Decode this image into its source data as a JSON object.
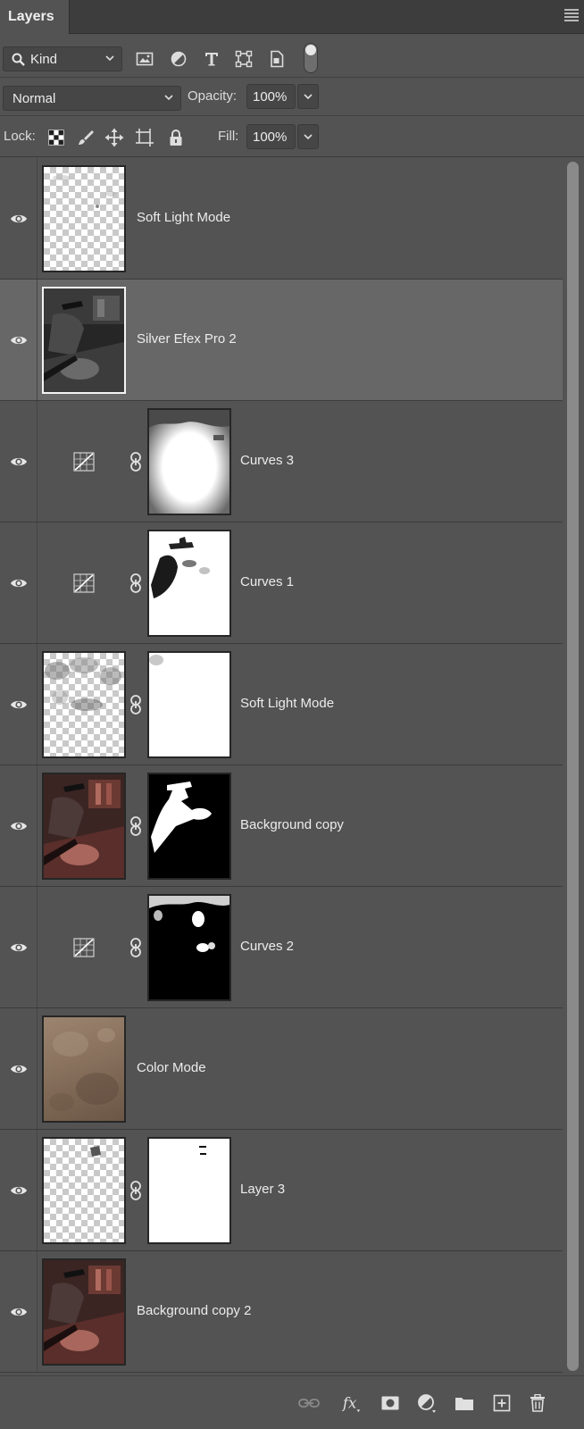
{
  "panel": {
    "tab_title": "Layers"
  },
  "filter": {
    "kind_label": "Kind"
  },
  "blend": {
    "mode": "Normal",
    "opacity_label": "Opacity:",
    "opacity_value": "100%"
  },
  "lock": {
    "label": "Lock:",
    "fill_label": "Fill:",
    "fill_value": "100%"
  },
  "layers": [
    {
      "name": "Soft Light Mode",
      "visible": true,
      "selected": false
    },
    {
      "name": "Silver Efex Pro 2",
      "visible": true,
      "selected": true
    },
    {
      "name": "Curves 3",
      "visible": true,
      "selected": false
    },
    {
      "name": "Curves 1",
      "visible": true,
      "selected": false
    },
    {
      "name": "Soft Light Mode",
      "visible": true,
      "selected": false
    },
    {
      "name": "Background copy",
      "visible": true,
      "selected": false
    },
    {
      "name": "Curves 2",
      "visible": true,
      "selected": false
    },
    {
      "name": "Color Mode",
      "visible": true,
      "selected": false
    },
    {
      "name": "Layer 3",
      "visible": true,
      "selected": false
    },
    {
      "name": "Background copy 2",
      "visible": true,
      "selected": false
    }
  ],
  "colors": {
    "panel_bg": "#535353",
    "selected_row": "#676767",
    "header_bg": "#3d3d3d",
    "text": "#ececec"
  }
}
